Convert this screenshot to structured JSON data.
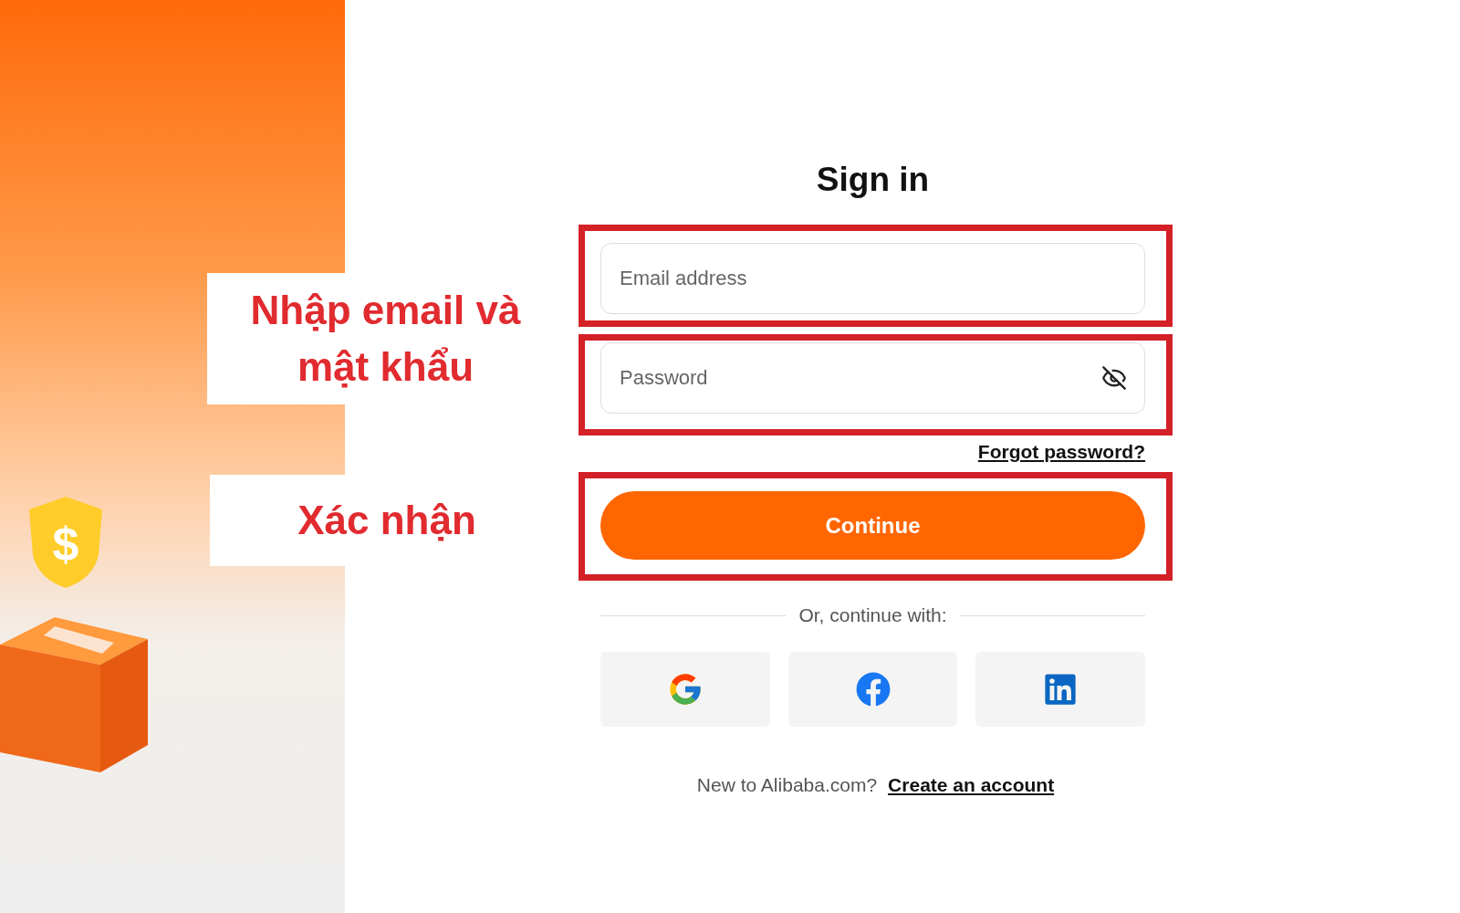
{
  "left_panel": {
    "badge_symbol": "$"
  },
  "form": {
    "title": "Sign in",
    "fields": [
      {
        "kind": "text",
        "placeholder": "Email address",
        "highlighted": true
      },
      {
        "kind": "password",
        "placeholder": "Password",
        "highlighted": true
      }
    ],
    "forgot_link": "Forgot password?",
    "continue_button": {
      "label": "Continue",
      "highlighted": true
    },
    "divider_text": "Or, continue with:",
    "social_buttons": [
      {
        "kind": "google"
      },
      {
        "kind": "facebook"
      },
      {
        "kind": "linkedin"
      }
    ],
    "footer": {
      "text": "New to Alibaba.com?",
      "link": "Create an account"
    }
  },
  "annotations": [
    {
      "text": "Nhập email và mật khẩu"
    },
    {
      "text": "Xác nhận"
    }
  ]
}
